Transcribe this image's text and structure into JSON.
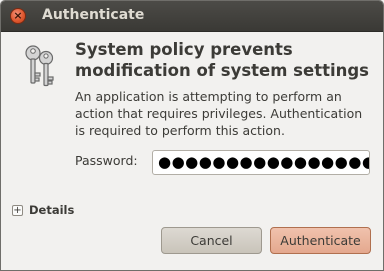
{
  "window": {
    "title": "Authenticate",
    "close_glyph": "×"
  },
  "icons": {
    "dialog_icon": "keys-icon",
    "close": "close-icon",
    "expander": "expander-plus-icon"
  },
  "dialog": {
    "heading": "System policy prevents modification of system settings",
    "description": "An application is attempting to perform an action that requires privileges. Authentication is required to perform this action.",
    "password_label": "Password:",
    "password_value": "●●●●●●●●●●●●●●●●",
    "details_expander": "+",
    "details_label": "Details"
  },
  "buttons": {
    "cancel_label": "Cancel",
    "authenticate_label": "Authenticate"
  },
  "colors": {
    "titlebar": "#3f3e3a",
    "title_text": "#dfdbd2",
    "close_button": "#e0582f",
    "authenticate_button": "#e9b39b",
    "window_bg": "#f2f1ef"
  }
}
